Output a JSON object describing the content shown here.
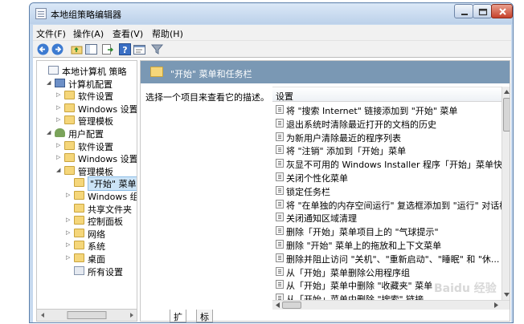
{
  "window": {
    "title": "本地组策略编辑器"
  },
  "menu": [
    "文件(F)",
    "操作(A)",
    "查看(V)",
    "帮助(H)"
  ],
  "tree": [
    {
      "label": "本地计算机 策略",
      "level": 0,
      "twisty": "",
      "icon": "policy-icon"
    },
    {
      "label": "计算机配置",
      "level": 1,
      "twisty": "◢",
      "icon": "computer-icon"
    },
    {
      "label": "软件设置",
      "level": 2,
      "twisty": "▷",
      "icon": "folder-icon"
    },
    {
      "label": "Windows 设置",
      "level": 2,
      "twisty": "▷",
      "icon": "folder-icon"
    },
    {
      "label": "管理模板",
      "level": 2,
      "twisty": "▷",
      "icon": "folder-icon"
    },
    {
      "label": "用户配置",
      "level": 1,
      "twisty": "◢",
      "icon": "user-icon"
    },
    {
      "label": "软件设置",
      "level": 2,
      "twisty": "▷",
      "icon": "folder-icon"
    },
    {
      "label": "Windows 设置",
      "level": 2,
      "twisty": "▷",
      "icon": "folder-icon"
    },
    {
      "label": "管理模板",
      "level": 2,
      "twisty": "◢",
      "icon": "folder-icon"
    },
    {
      "label": "\"开始\" 菜单",
      "level": 3,
      "twisty": "",
      "icon": "folder-icon",
      "selected": true
    },
    {
      "label": "Windows 组",
      "level": 3,
      "twisty": "▷",
      "icon": "folder-icon"
    },
    {
      "label": "共享文件夹",
      "level": 3,
      "twisty": "",
      "icon": "folder-icon"
    },
    {
      "label": "控制面板",
      "level": 3,
      "twisty": "▷",
      "icon": "folder-icon"
    },
    {
      "label": "网络",
      "level": 3,
      "twisty": "▷",
      "icon": "folder-icon"
    },
    {
      "label": "系统",
      "level": 3,
      "twisty": "▷",
      "icon": "folder-icon"
    },
    {
      "label": "桌面",
      "level": 3,
      "twisty": "▷",
      "icon": "folder-icon"
    },
    {
      "label": "所有设置",
      "level": 3,
      "twisty": "",
      "icon": "settings-icon"
    }
  ],
  "right": {
    "header": "\"开始\" 菜单和任务栏",
    "description": "选择一个项目来查看它的描述。",
    "column": "设置",
    "settings": [
      "将 \"搜索 Internet\" 链接添加到 \"开始\" 菜单",
      "退出系统时清除最近打开的文档的历史",
      "为新用户清除最近的程序列表",
      "将 \"注销\" 添加到「开始」菜单",
      "灰显不可用的 Windows Installer 程序「开始」菜单快捷方...",
      "关闭个性化菜单",
      "锁定任务栏",
      "将 \"在单独的内存空间运行\" 复选框添加到 \"运行\" 对话框",
      "关闭通知区域清理",
      "删除「开始」菜单项目上的 \"气球提示\"",
      "删除 \"开始\" 菜单上的拖放和上下文菜单",
      "删除并阻止访问 \"关机\"、\"重新启动\"、\"睡眠\" 和 \"休...",
      "从「开始」菜单删除公用程序组",
      "从「开始」菜单中删除 \"收藏夹\" 菜单",
      "从「开始」菜单中删除 \"搜索\" 链接"
    ]
  },
  "tabs": [
    "扩展",
    "标准"
  ],
  "watermark": "Baidu 经验"
}
